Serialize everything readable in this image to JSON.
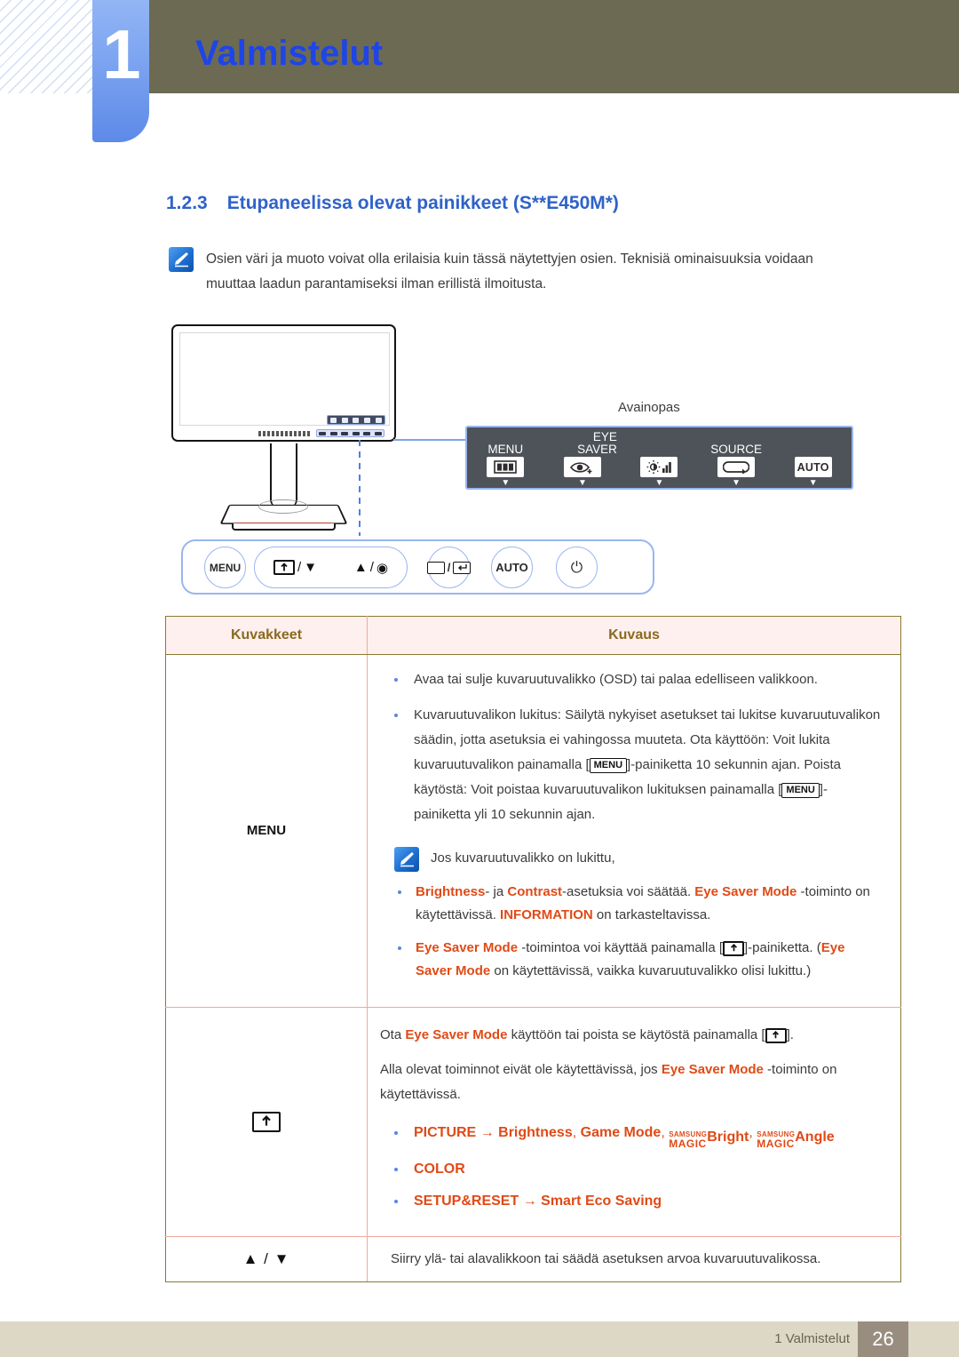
{
  "header": {
    "chapter_number": "1",
    "chapter_title": "Valmistelut"
  },
  "section": {
    "number": "1.2.3",
    "title": "Etupaneelissa olevat painikkeet (S**E450M*)"
  },
  "top_note": {
    "icon": "note-pen-icon",
    "text": "Osien väri ja muoto voivat olla erilaisia kuin tässä näytettyjen osien. Teknisiä ominaisuuksia voidaan muuttaa laadun parantamiseksi ilman erillistä ilmoitusta."
  },
  "illustration": {
    "key_guide_label": "Avainopas",
    "key_guide_items": [
      {
        "caption_line1": "",
        "caption_line2": "MENU",
        "icon": "menu-bars-icon"
      },
      {
        "caption_line1": "EYE",
        "caption_line2": "SAVER",
        "icon": "eye-plus-icon"
      },
      {
        "caption_line1": "",
        "caption_line2": "",
        "icon": "brightness-contrast-icon"
      },
      {
        "caption_line1": "",
        "caption_line2": "SOURCE",
        "icon": "source-loop-icon"
      },
      {
        "caption_line1": "",
        "caption_line2": "",
        "icon": "auto-icon",
        "label": "AUTO"
      }
    ],
    "buttons": [
      {
        "name": "menu-button",
        "label": "MENU"
      },
      {
        "name": "eyesaver-down-button",
        "label": "/"
      },
      {
        "name": "up-enter-button",
        "label": "/"
      },
      {
        "name": "source-enter-button",
        "label": "/"
      },
      {
        "name": "auto-button",
        "label": "AUTO"
      },
      {
        "name": "power-button",
        "label": "⏻"
      }
    ]
  },
  "table": {
    "headers": [
      "Kuvakkeet",
      "Kuvaus"
    ],
    "rows": [
      {
        "icon_label": "MENU",
        "bullets": [
          "Avaa tai sulje kuvaruutuvalikko (OSD) tai palaa edelliseen valikkoon.",
          "Kuvaruutuvalikon lukitus: Säilytä nykyiset asetukset tai lukitse kuvaruutuvalikon säädin, jotta asetuksia ei vahingossa muuteta. Ota käyttöön: Voit lukita kuvaruutuvalikon painamalla [MENU]-painiketta 10 sekunnin ajan. Poista käytöstä: Voit poistaa kuvaruutuvalikon lukituksen painamalla [MENU]-painiketta yli 10 sekunnin ajan."
        ],
        "inner_note": {
          "lead": "Jos kuvaruutuvalikko on lukittu,",
          "items": [
            "Brightness- ja Contrast-asetuksia voi säätää. Eye Saver Mode -toiminto on käytettävissä. INFORMATION on tarkasteltavissa.",
            "Eye Saver Mode -toimintoa voi käyttää painamalla [ ]-painiketta. (Eye Saver Mode on käytettävissä, vaikka kuvaruutuvalikko olisi lukittu.)"
          ]
        }
      },
      {
        "icon_label": "eye-saver-icon",
        "para1": "Ota Eye Saver Mode käyttöön tai poista se käytöstä painamalla [ ].",
        "para2": "Alla olevat toiminnot eivät ole käytettävissä, jos Eye Saver Mode -toiminto on käytettävissä.",
        "functions": [
          "PICTURE → Brightness, Game Mode, SAMSUNG MAGIC Bright, SAMSUNG MAGIC Angle",
          "COLOR",
          "SETUP&RESET → Smart Eco Saving"
        ]
      },
      {
        "icon_label": "▲ / ▼",
        "description": "Siirry ylä- tai alavalikkoon tai säädä asetuksen arvoa kuvaruutuvalikossa."
      }
    ]
  },
  "footer": {
    "text": "1 Valmistelut",
    "page": "26"
  },
  "colors": {
    "header_olive": "#6d6a54",
    "header_blue": "#1d45e8",
    "section_blue": "#2f62c9",
    "table_border": "#8a7a31",
    "table_inner": "#f0a99b",
    "table_head_bg": "#fdf0ee",
    "accent_orange": "#e04a16",
    "footer_bar": "#ddd8c6",
    "footer_page": "#998d80"
  }
}
